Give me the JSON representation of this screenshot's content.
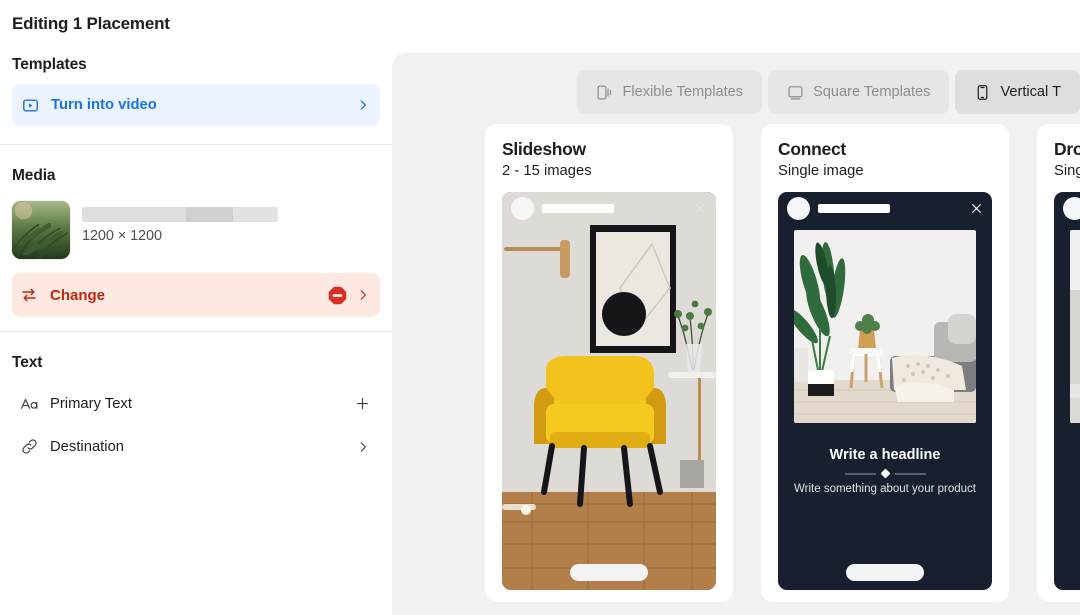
{
  "sidebar": {
    "editing_title": "Editing 1 Placement",
    "templates": {
      "heading": "Templates",
      "video_row": {
        "label": "Turn into video",
        "icon": "play-box-icon",
        "chevron": "chevron-right-icon",
        "accent": "#1b74e4",
        "bg": "#ebf3fe"
      }
    },
    "media": {
      "heading": "Media",
      "thumbnail_alt": "fern-photo-thumbnail",
      "filename_redacted": true,
      "dimensions": "1200 × 1200",
      "change_row": {
        "label": "Change",
        "icon": "swap-arrows-icon",
        "badge": "block-octagon-icon",
        "chevron": "chevron-right-icon",
        "accent": "#c0280f",
        "bg": "#fde8e2"
      }
    },
    "text": {
      "heading": "Text",
      "rows": [
        {
          "label": "Primary Text",
          "icon": "aa-text-icon",
          "action_icon": "plus-icon"
        },
        {
          "label": "Destination",
          "icon": "link-icon",
          "action_icon": "chevron-right-icon"
        }
      ]
    }
  },
  "main": {
    "tabs": [
      {
        "label": "Flexible Templates",
        "icon": "flexible-device-icon",
        "active": false
      },
      {
        "label": "Square Templates",
        "icon": "square-device-icon",
        "active": false
      },
      {
        "label": "Vertical T",
        "icon": "vertical-phone-icon",
        "active": true
      }
    ],
    "cards": [
      {
        "title": "Slideshow",
        "subtitle": "2 - 15 images",
        "preview": "living-room-yellow-armchair",
        "close_icon": "close-icon"
      },
      {
        "title": "Connect",
        "subtitle": "Single image",
        "preview": "minimal-interior-plant-sofa",
        "close_icon": "close-icon",
        "headline": "Write a headline",
        "subcopy": "Write something about your product"
      },
      {
        "title": "Drop",
        "subtitle": "Singl",
        "preview": "bedroom-interior",
        "close_icon": "close-icon"
      }
    ]
  }
}
